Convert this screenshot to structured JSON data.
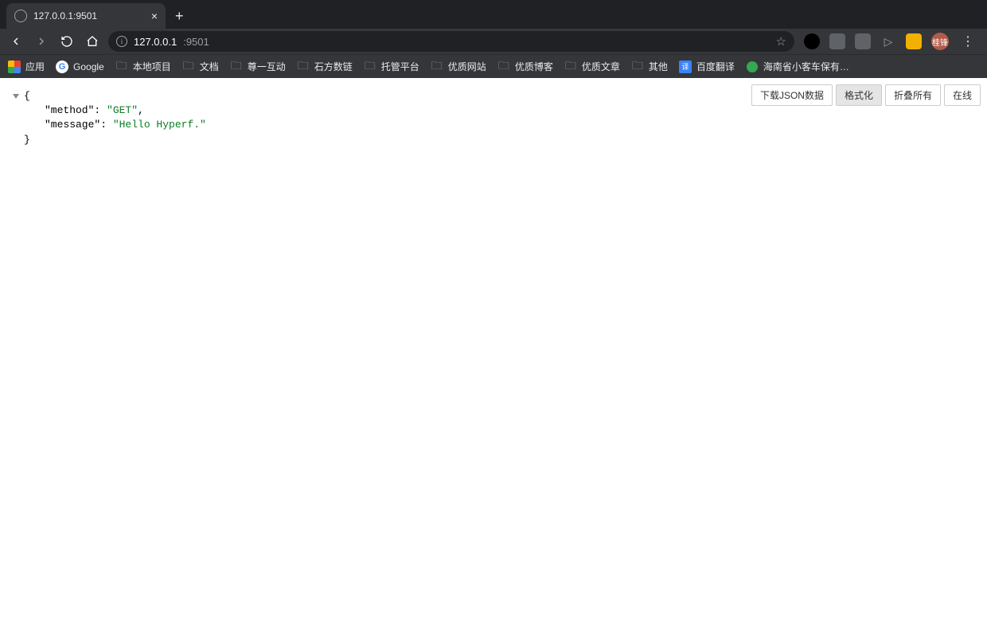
{
  "tab": {
    "title": "127.0.0.1:9501",
    "close_glyph": "×",
    "new_tab_glyph": "+"
  },
  "address": {
    "host": "127.0.0.1",
    "port": ":9501",
    "info_glyph": "i",
    "star_glyph": "☆"
  },
  "nav": {
    "back": "←",
    "forward": "→",
    "reload": "⟳",
    "home": "⌂"
  },
  "avatar_text": "桂锋",
  "kebab": "⋮",
  "bookmarks": {
    "apps": "应用",
    "google": "Google",
    "google_g": "G",
    "items": [
      "本地项目",
      "文档",
      "尊一互动",
      "石方数链",
      "托管平台",
      "优质网站",
      "优质博客",
      "优质文章",
      "其他"
    ],
    "translate": "百度翻译",
    "translate_badge": "译",
    "hainan": "海南省小客车保有…"
  },
  "json_actions": {
    "download": "下载JSON数据",
    "format": "格式化",
    "collapse": "折叠所有",
    "online": "在线"
  },
  "json": {
    "open": "{",
    "close": "}",
    "k_method": "\"method\"",
    "sep": ": ",
    "v_method": "\"GET\"",
    "comma": ",",
    "k_message": "\"message\"",
    "v_message": "\"Hello Hyperf.\""
  }
}
